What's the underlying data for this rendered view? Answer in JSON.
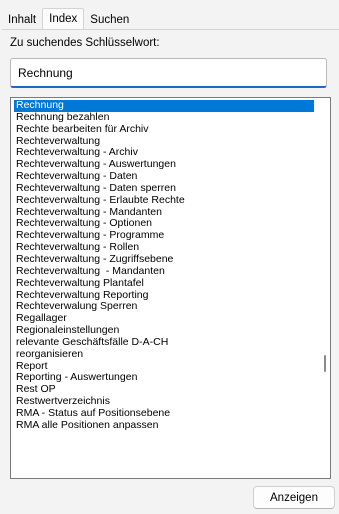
{
  "tabs": [
    {
      "label": "Inhalt",
      "active": false
    },
    {
      "label": "Index",
      "active": true
    },
    {
      "label": "Suchen",
      "active": false
    }
  ],
  "search": {
    "label": "Zu suchendes Schlüsselwort:",
    "value": "Rechnung"
  },
  "list": {
    "selected_index": 0,
    "items": [
      "Rechnung",
      "Rechnung bezahlen",
      "Rechte bearbeiten für Archiv",
      "Rechteverwaltung",
      "Rechteverwaltung - Archiv",
      "Rechteverwaltung - Auswertungen",
      "Rechteverwaltung - Daten",
      "Rechteverwaltung - Daten sperren",
      "Rechteverwaltung - Erlaubte Rechte",
      "Rechteverwaltung - Mandanten",
      "Rechteverwaltung - Optionen",
      "Rechteverwaltung - Programme",
      "Rechteverwaltung - Rollen",
      "Rechteverwaltung - Zugriffsebene",
      "Rechteverwaltung  - Mandanten",
      "Rechteverwaltung Plantafel",
      "Rechteverwaltung Reporting",
      "Rechteverwalung Sperren",
      "Regallager",
      "Regionaleinstellungen",
      "relevante Geschäftsfälle D-A-CH",
      "reorganisieren",
      "Report",
      "Reporting - Auswertungen",
      "Rest OP",
      "Restwertverzeichnis",
      "RMA - Status auf Positionsebene",
      "RMA alle Positionen anpassen"
    ]
  },
  "buttons": {
    "show_label": "Anzeigen"
  }
}
